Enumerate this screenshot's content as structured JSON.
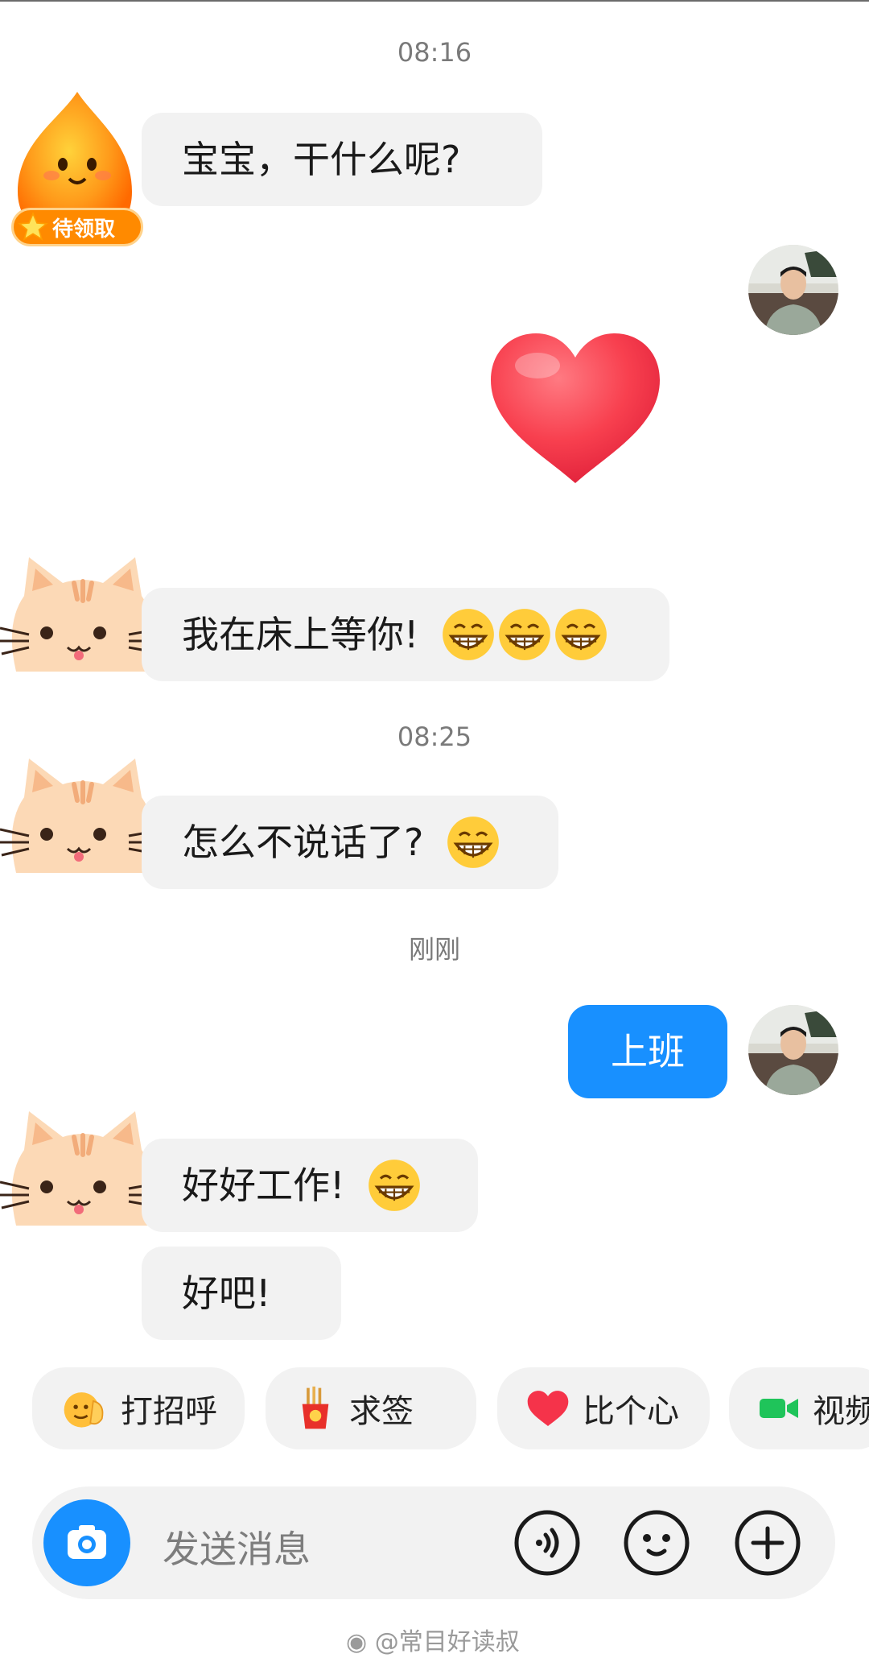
{
  "timestamps": [
    "08:16",
    "08:25",
    "刚刚"
  ],
  "badges": {
    "pending": "待领取"
  },
  "messages": {
    "m1": "宝宝，干什么呢?",
    "m2": "我在床上等你!",
    "m3": "怎么不说话了?",
    "m4": "上班",
    "m5": "好好工作!",
    "m6": "好吧!"
  },
  "quick_actions": [
    {
      "label": "打招呼",
      "icon": "wave-emoji-icon"
    },
    {
      "label": "求签",
      "icon": "fortune-sticks-icon"
    },
    {
      "label": "比个心",
      "icon": "heart-icon"
    },
    {
      "label": "视频",
      "icon": "video-camera-icon"
    }
  ],
  "input": {
    "placeholder": "发送消息"
  },
  "watermark": "@常目好读叔",
  "colors": {
    "accent_blue": "#1890ff",
    "bubble_gray": "#f2f2f2",
    "heart_red": "#f5334a",
    "video_green": "#1fc45a"
  }
}
